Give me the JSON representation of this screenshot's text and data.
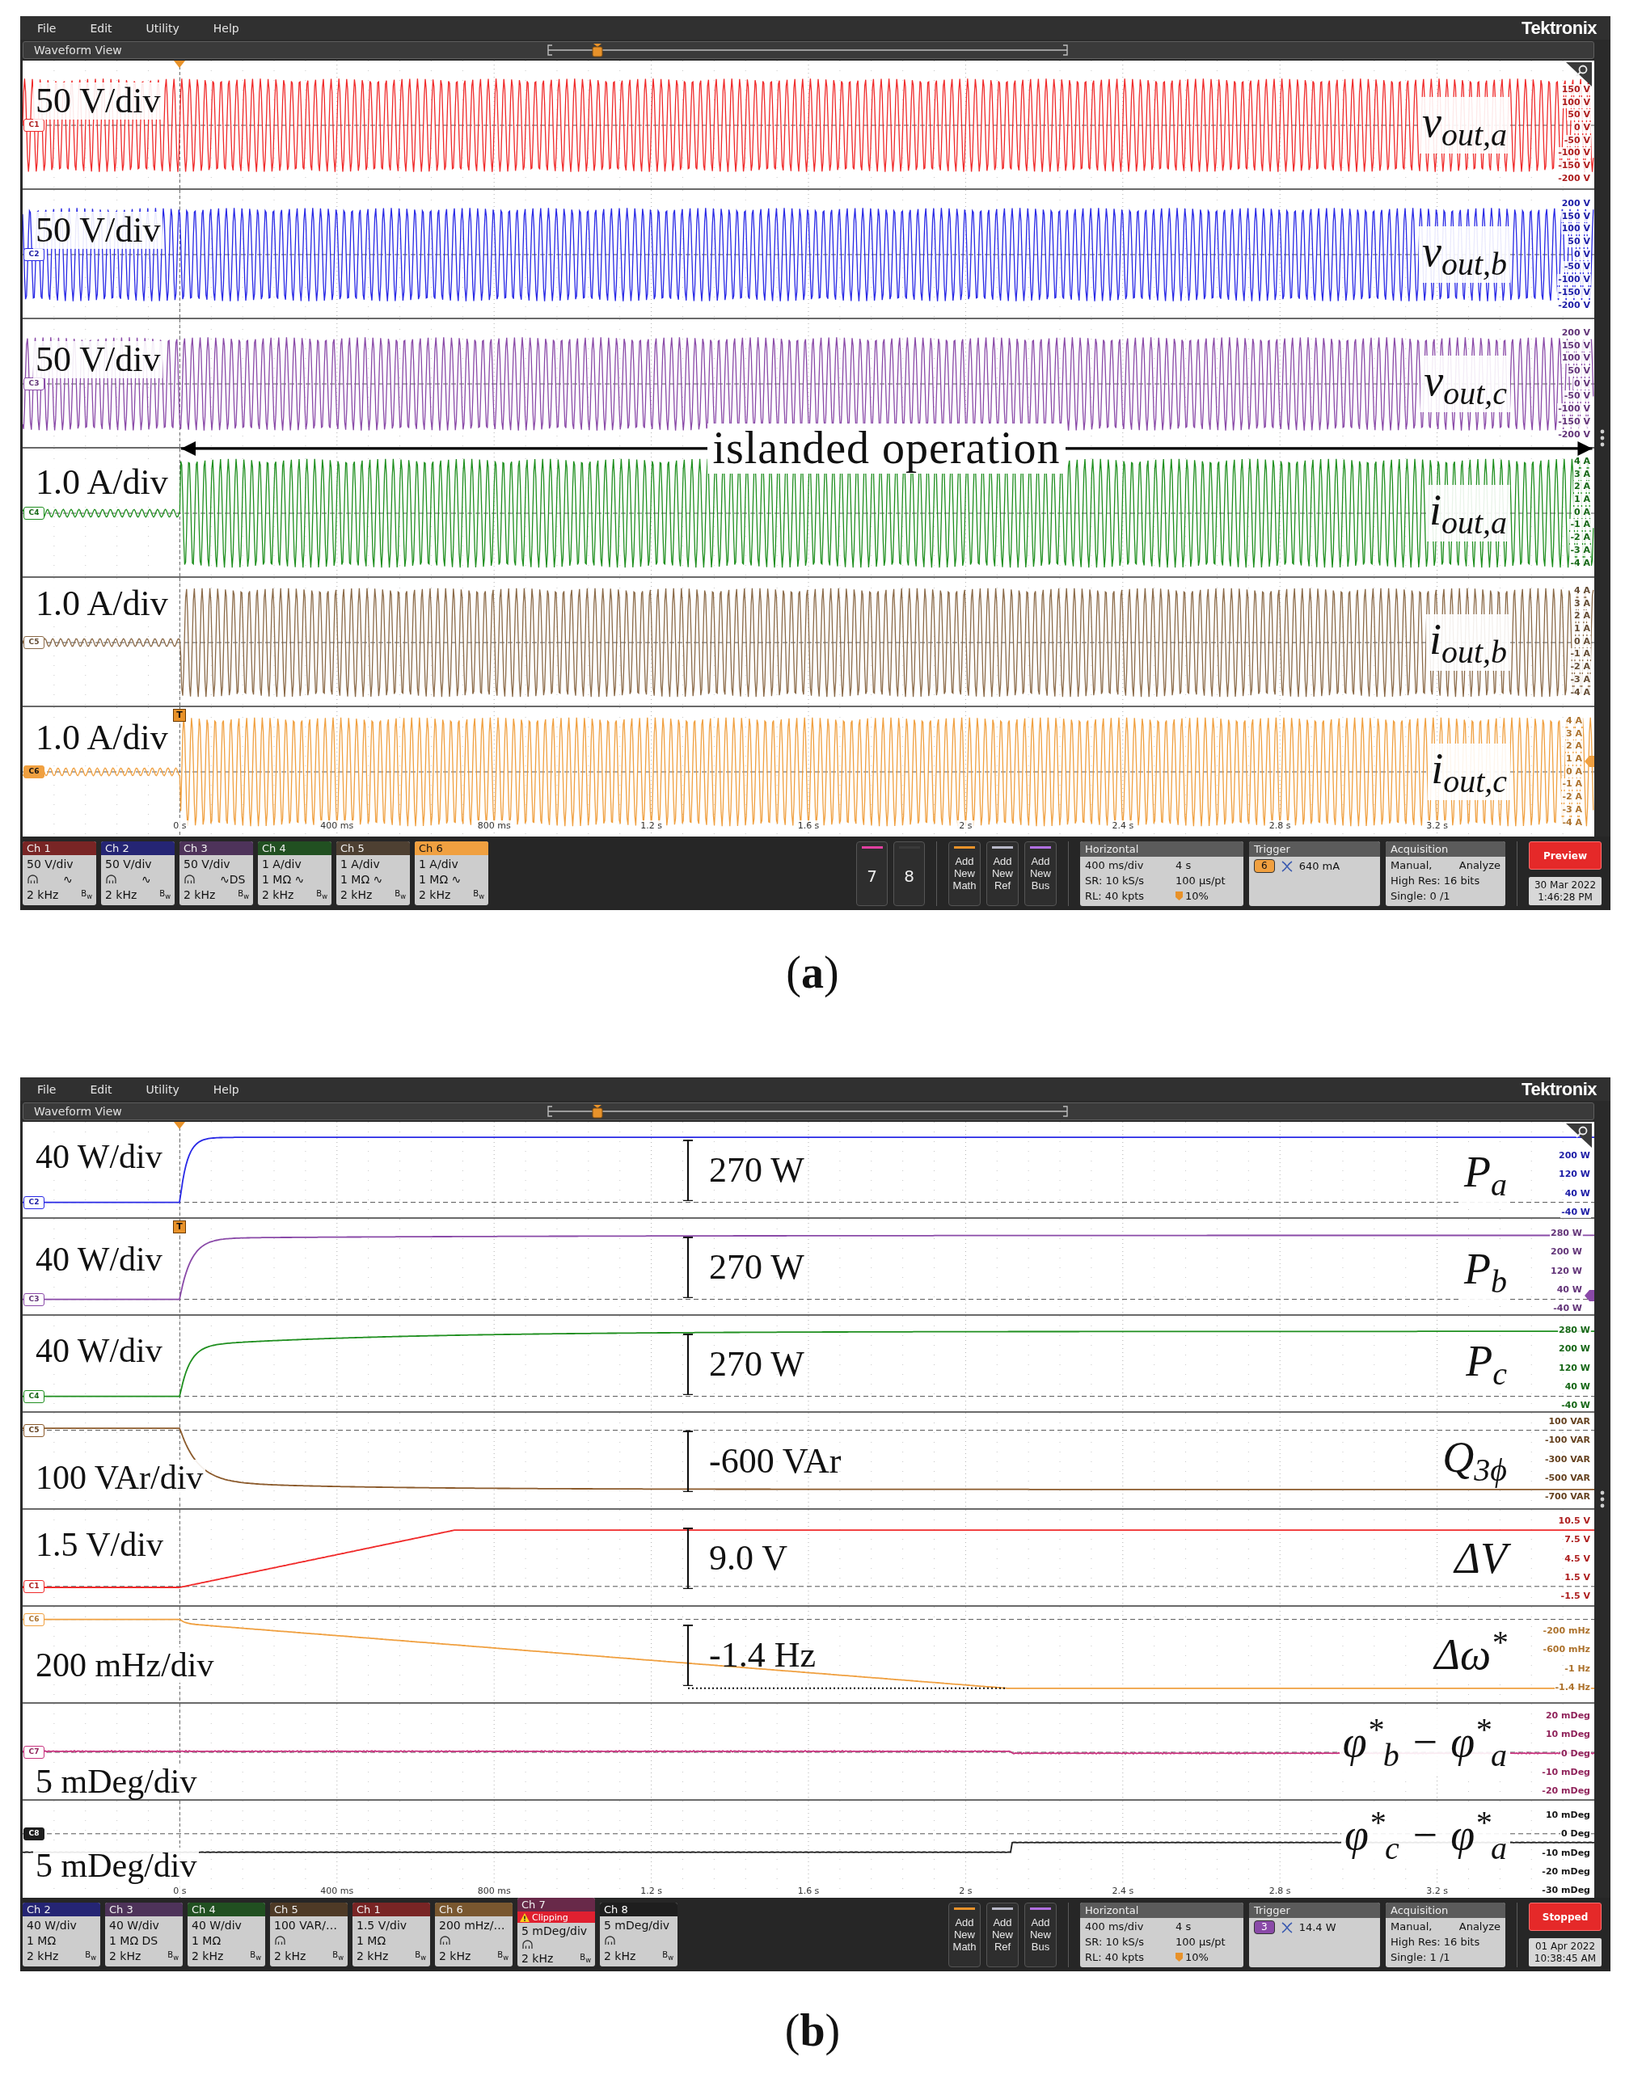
{
  "figures": [
    {
      "caption": "(**a**)",
      "menu": [
        "File",
        "Edit",
        "Utility",
        "Help"
      ],
      "logo": "Tektronix",
      "view_title": "Waveform View",
      "trigger_mark": "T",
      "lanes": [
        {
          "badge": "C1",
          "selected": false,
          "color": "#f02a2a",
          "scale": "50 V/div",
          "label": "v$_{out,a}$",
          "ticks": [
            "150 V",
            "100 V",
            "50 V",
            "0 V",
            "-50 V",
            "-100 V",
            "-150 V",
            "-200 V"
          ]
        },
        {
          "badge": "C2",
          "selected": false,
          "color": "#2828e6",
          "scale": "50 V/div",
          "label": "v$_{out,b}$",
          "ticks": [
            "200 V",
            "150 V",
            "100 V",
            "50 V",
            "0 V",
            "-50 V",
            "-100 V",
            "-150 V",
            "-200 V"
          ]
        },
        {
          "badge": "C3",
          "selected": false,
          "color": "#8a4aa8",
          "scale": "50 V/div",
          "label": "v$_{out,c}$",
          "ticks": [
            "200 V",
            "150 V",
            "100 V",
            "50 V",
            "0 V",
            "-50 V",
            "-100 V",
            "-150 V",
            "-200 V"
          ]
        },
        {
          "badge": "C4",
          "selected": false,
          "color": "#1f8f1f",
          "scale": "1.0 A/div",
          "label": "i$_{out,a}$",
          "ticks": [
            "4 A",
            "3 A",
            "2 A",
            "1 A",
            "0 A",
            "-1 A",
            "-2 A",
            "-3 A",
            "-4 A"
          ]
        },
        {
          "badge": "C5",
          "selected": false,
          "color": "#8b6a48",
          "scale": "1.0 A/div",
          "label": "i$_{out,b}$",
          "ticks": [
            "4 A",
            "3 A",
            "2 A",
            "1 A",
            "0 A",
            "-1 A",
            "-2 A",
            "-3 A",
            "-4 A"
          ]
        },
        {
          "badge": "C6",
          "selected": true,
          "color": "#f0a040",
          "scale": "1.0 A/div",
          "label": "i$_{out,c}$",
          "ticks": [
            "4 A",
            "3 A",
            "2 A",
            "1 A",
            "0 A",
            "-1 A",
            "-2 A",
            "-3 A",
            "-4 A"
          ]
        }
      ],
      "annotation": "islanded operation",
      "x_ticks": [
        "0 s",
        "400 ms",
        "800 ms",
        "1.2 s",
        "1.6 s",
        "2 s",
        "2.4 s",
        "2.8 s",
        "3.2 s"
      ],
      "status": {
        "channels": [
          {
            "title": "Ch 1",
            "selected": false,
            "scale": "50 V/div",
            "probe": true,
            "coupling": "∿",
            "bandwidth": "2 kHz",
            "bw": "B$_{w}$"
          },
          {
            "title": "Ch 2",
            "selected": false,
            "scale": "50 V/div",
            "probe": true,
            "coupling": "∿",
            "bandwidth": "2 kHz",
            "bw": "B$_{w}$"
          },
          {
            "title": "Ch 3",
            "selected": false,
            "scale": "50 V/div",
            "probe": true,
            "coupling": "∿DS",
            "bandwidth": "2 kHz",
            "bw": "B$_{w}$"
          },
          {
            "title": "Ch 4",
            "selected": false,
            "scale": "1 A/div",
            "probe": false,
            "coupling": "1 MΩ ∿",
            "bandwidth": "2 kHz",
            "bw": "B$_{w}$"
          },
          {
            "title": "Ch 5",
            "selected": false,
            "scale": "1 A/div",
            "probe": false,
            "coupling": "1 MΩ ∿",
            "bandwidth": "2 kHz",
            "bw": "B$_{w}$"
          },
          {
            "title": "Ch 6",
            "selected": true,
            "scale": "1 A/div",
            "probe": false,
            "coupling": "1 MΩ ∿",
            "bandwidth": "2 kHz",
            "bw": "B$_{w}$"
          }
        ],
        "extra_channels": [
          {
            "label": "7",
            "color": "#e040a0"
          },
          {
            "label": "8",
            "color": "#3a3a3a"
          }
        ],
        "add_buttons": [
          {
            "label": "Add New Math",
            "color": "#e8922a"
          },
          {
            "label": "Add New Ref",
            "color": "#b8b8c8"
          },
          {
            "label": "Add New Bus",
            "color": "#b070e0"
          }
        ],
        "horizontal": {
          "title": "Horizontal",
          "values": [
            "400 ms/div",
            "4 s",
            "SR: 10 kS/s",
            "100 µs/pt",
            "RL: 40 kpts",
            "10%"
          ]
        },
        "trigger": {
          "title": "Trigger",
          "source": "6",
          "color": "#f0a040",
          "level": "640 mA"
        },
        "acquisition": {
          "title": "Acquisition",
          "values": [
            "Manual,",
            "Analyze",
            "High Res: 16 bits",
            "Single: 0 /1"
          ]
        },
        "run_state": "Preview",
        "date": "30 Mar 2022",
        "time": "1:46:28 PM"
      }
    },
    {
      "caption": "(**b**)",
      "menu": [
        "File",
        "Edit",
        "Utility",
        "Help"
      ],
      "logo": "Tektronix",
      "view_title": "Waveform View",
      "trigger_mark": "T",
      "lanes": [
        {
          "badge": "C2",
          "selected": false,
          "color": "#2828e6",
          "scale": "40 W/div",
          "label": "P$_{a}$",
          "measurement": "270 W",
          "ticks": [
            "200 W",
            "120 W",
            "40 W",
            "-40 W"
          ]
        },
        {
          "badge": "C3",
          "selected": false,
          "color": "#8a4aa8",
          "scale": "40 W/div",
          "label": "P$_{b}$",
          "measurement": "270 W",
          "ticks": [
            "280 W",
            "200 W",
            "120 W",
            "40 W",
            "-40 W"
          ]
        },
        {
          "badge": "C4",
          "selected": false,
          "color": "#1f8f1f",
          "scale": "40 W/div",
          "label": "P$_{c}$",
          "measurement": "270 W",
          "ticks": [
            "280 W",
            "200 W",
            "120 W",
            "40 W",
            "-40 W"
          ]
        },
        {
          "badge": "C5",
          "selected": false,
          "color": "#8b5a2b",
          "scale": "100 VAr/div",
          "label": "Q$_{3ϕ}$",
          "measurement": "-600 VAr",
          "ticks": [
            "100 VAR",
            "-100 VAR",
            "-300 VAR",
            "-500 VAR",
            "-700 VAR"
          ]
        },
        {
          "badge": "C1",
          "selected": false,
          "color": "#f02a2a",
          "scale": "1.5 V/div",
          "label": "ΔV",
          "measurement": "9.0 V",
          "ticks": [
            "10.5 V",
            "7.5 V",
            "4.5 V",
            "1.5 V",
            "-1.5 V"
          ]
        },
        {
          "badge": "C6",
          "selected": false,
          "color": "#f0a040",
          "scale": "200 mHz/div",
          "label": "Δω$^{*}$",
          "measurement": "-1.4 Hz",
          "ticks": [
            "-200 mHz",
            "-600 mHz",
            "-1 Hz",
            "-1.4 Hz"
          ]
        },
        {
          "badge": "C7",
          "selected": false,
          "color": "#c8327e",
          "scale": "5 mDeg/div",
          "label": "φ$^{*}$$_{b}$ − φ$^{*}$$_{a}$",
          "ticks": [
            "20 mDeg",
            "10 mDeg",
            "0 Deg",
            "-10 mDeg",
            "-20 mDeg"
          ]
        },
        {
          "badge": "C8",
          "selected": true,
          "color": "#1e1e1e",
          "scale": "5 mDeg/div",
          "label": "φ$^{*}$$_{c}$ − φ$^{*}$$_{a}$",
          "ticks": [
            "10 mDeg",
            "0 Deg",
            "-10 mDeg",
            "-20 mDeg",
            "-30 mDeg"
          ]
        }
      ],
      "x_ticks": [
        "0 s",
        "400 ms",
        "800 ms",
        "1.2 s",
        "1.6 s",
        "2 s",
        "2.4 s",
        "2.8 s",
        "3.2 s"
      ],
      "status": {
        "channels": [
          {
            "title": "Ch 2",
            "selected": false,
            "scale": "40 W/div",
            "probe": false,
            "coupling": "1 MΩ",
            "bandwidth": "2 kHz",
            "bw": "B$_{w}$"
          },
          {
            "title": "Ch 3",
            "selected": false,
            "scale": "40 W/div",
            "probe": false,
            "coupling": "1 MΩ DS",
            "bandwidth": "2 kHz",
            "bw": "B$_{w}$"
          },
          {
            "title": "Ch 4",
            "selected": false,
            "scale": "40 W/div",
            "probe": false,
            "coupling": "1 MΩ",
            "bandwidth": "2 kHz",
            "bw": "B$_{w}$"
          },
          {
            "title": "Ch 5",
            "selected": false,
            "scale": "100 VAR/…",
            "probe": true,
            "bandwidth": "2 kHz",
            "bw": "B$_{w}$"
          },
          {
            "title": "Ch 1",
            "selected": false,
            "scale": "1.5 V/div",
            "probe": false,
            "coupling": "1 MΩ",
            "bandwidth": "2 kHz",
            "bw": "B$_{w}$"
          },
          {
            "title": "Ch 6",
            "selected": false,
            "scale": "200 mHz/…",
            "probe": true,
            "bandwidth": "2 kHz",
            "bw": "B$_{w}$"
          },
          {
            "title": "Ch 7",
            "selected": false,
            "warning": "Clipping",
            "scale": "5 mDeg/div",
            "probe": true,
            "bandwidth": "2 kHz",
            "bw": "B$_{w}$"
          },
          {
            "title": "Ch 8",
            "selected": true,
            "scale": "5 mDeg/div",
            "probe": true,
            "bandwidth": "2 kHz",
            "bw": "B$_{w}$"
          }
        ],
        "add_buttons": [
          {
            "label": "Add New Math",
            "color": "#e8922a"
          },
          {
            "label": "Add New Ref",
            "color": "#b8b8c8"
          },
          {
            "label": "Add New Bus",
            "color": "#b070e0"
          }
        ],
        "horizontal": {
          "title": "Horizontal",
          "values": [
            "400 ms/div",
            "4 s",
            "SR: 10 kS/s",
            "100 µs/pt",
            "RL: 40 kpts",
            "10%"
          ]
        },
        "trigger": {
          "title": "Trigger",
          "source": "3",
          "color": "#8a4aa8",
          "level": "14.4 W"
        },
        "acquisition": {
          "title": "Acquisition",
          "values": [
            "Manual,",
            "Analyze",
            "High Res: 16 bits",
            "Single: 1 /1"
          ]
        },
        "run_state": "Stopped",
        "date": "01 Apr 2022",
        "time": "10:38:45 AM"
      }
    }
  ]
}
